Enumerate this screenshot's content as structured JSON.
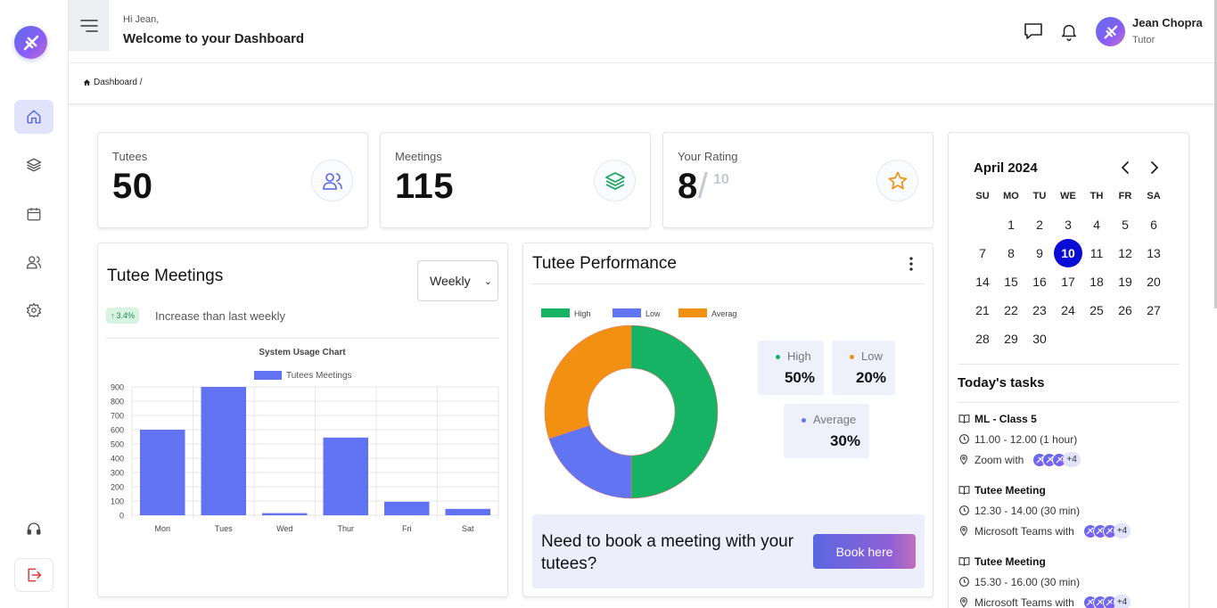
{
  "header": {
    "greeting": "Hi Jean,",
    "welcome": "Welcome to your Dashboard",
    "user_name": "Jean Chopra",
    "user_role": "Tutor"
  },
  "breadcrumb": {
    "label": "Dashboard /"
  },
  "sidebar": {
    "items": [
      {
        "name": "home",
        "active": true
      },
      {
        "name": "layers"
      },
      {
        "name": "calendar"
      },
      {
        "name": "users"
      },
      {
        "name": "settings"
      }
    ]
  },
  "stats": {
    "tutees": {
      "label": "Tutees",
      "value": "50"
    },
    "meetings": {
      "label": "Meetings",
      "value": "115"
    },
    "rating": {
      "label": "Your Rating",
      "value": "8",
      "slash": "/",
      "max": "10"
    }
  },
  "meetings_panel": {
    "title": "Tutee Meetings",
    "select_value": "Weekly",
    "pill": "3.4%",
    "pill_note": "Increase than last weekly"
  },
  "performance_panel": {
    "title": "Tutee Performance",
    "high_label": "High",
    "high_value": "50%",
    "low_label": "Low",
    "low_value": "20%",
    "avg_label": "Average",
    "avg_value": "30%",
    "book_text": "Need to book a meeting with your tutees?",
    "book_button": "Book here"
  },
  "calendar": {
    "title": "April 2024",
    "dow": [
      "SU",
      "MO",
      "TU",
      "WE",
      "TH",
      "FR",
      "SA"
    ],
    "first_weekday": 1,
    "days_in_month": 30,
    "today": 10
  },
  "tasks": {
    "title": "Today's tasks",
    "items": [
      {
        "name": "ML - Class 5",
        "time": "11.00 - 12.00 (1 hour)",
        "via": "Zoom with",
        "extra": "+4"
      },
      {
        "name": "Tutee Meeting",
        "time": "12.30 - 14.00 (30 min)",
        "via": "Microsoft Teams with",
        "extra": "+4"
      },
      {
        "name": "Tutee Meeting",
        "time": "15.30 - 16.00 (30 min)",
        "via": "Microsoft Teams with",
        "extra": "+4"
      }
    ]
  },
  "colors": {
    "accent": "#6173f2",
    "high": "#16b364",
    "low": "#6174f1",
    "average": "#f29111",
    "today": "#0b0bd6"
  },
  "chart_data": [
    {
      "type": "bar",
      "title": "System Usage Chart",
      "categories": [
        "Mon",
        "Tues",
        "Wed",
        "Thur",
        "Fri",
        "Sat"
      ],
      "series": [
        {
          "name": "Tutees Meetings",
          "values": [
            600,
            900,
            15,
            545,
            95,
            45
          ]
        }
      ],
      "ylim": [
        0,
        900
      ],
      "yticks": [
        0,
        100,
        200,
        300,
        400,
        500,
        600,
        700,
        800,
        900
      ],
      "legend": "top",
      "grid": true
    },
    {
      "type": "pie",
      "categories": [
        "High",
        "Low",
        "Average"
      ],
      "values": [
        50,
        20,
        30
      ],
      "legend": "top-left"
    }
  ]
}
